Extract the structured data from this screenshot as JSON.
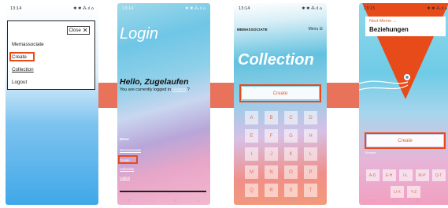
{
  "status_bar": {
    "time": "13:14",
    "icons": "✱ ✱ ⁂.ıl ⌂"
  },
  "status_bar_4": {
    "time": "13:15",
    "icons": "✱ ✱ ⁂.ıl ⌂"
  },
  "nav_bar": {
    "back": "◁",
    "home": "○",
    "recent": "□",
    "extra": "⇣"
  },
  "colors": {
    "highlight": "#e84b1a",
    "connector": "#e8735a",
    "accent": "#e06030"
  },
  "screen1": {
    "close_label": "Close",
    "close_icon": "close-icon",
    "items": [
      "Memassociate",
      "Create",
      "Collection",
      "Logout"
    ]
  },
  "screen2": {
    "title": "Login",
    "greeting": "Hello, Zugelaufen",
    "logged_prefix": "You are currently logged in",
    "logged_name": "Helena",
    "logged_suffix": "?",
    "menu_label": "Menu",
    "menu_items": [
      "Memassociate",
      "Create",
      "Collection",
      "Logout"
    ]
  },
  "screen3": {
    "brand": "MEMASSOCIATE",
    "menu_label": "Menu ☰",
    "title": "Collection",
    "create_label": "Create",
    "keys": [
      "A",
      "B",
      "C",
      "D",
      "E",
      "F",
      "G",
      "H",
      "I",
      "J",
      "K",
      "L",
      "M",
      "N",
      "O",
      "P",
      "Q",
      "R",
      "S",
      "T"
    ]
  },
  "screen4": {
    "next_label": "Next Memo →",
    "title": "Beziehungen",
    "create_label": "Create",
    "small_label": "Browse",
    "row1": [
      "A-D",
      "E-H",
      "I-L",
      "M-P",
      "Q-T"
    ],
    "row2": [
      "U-X",
      "Y-Z"
    ]
  }
}
